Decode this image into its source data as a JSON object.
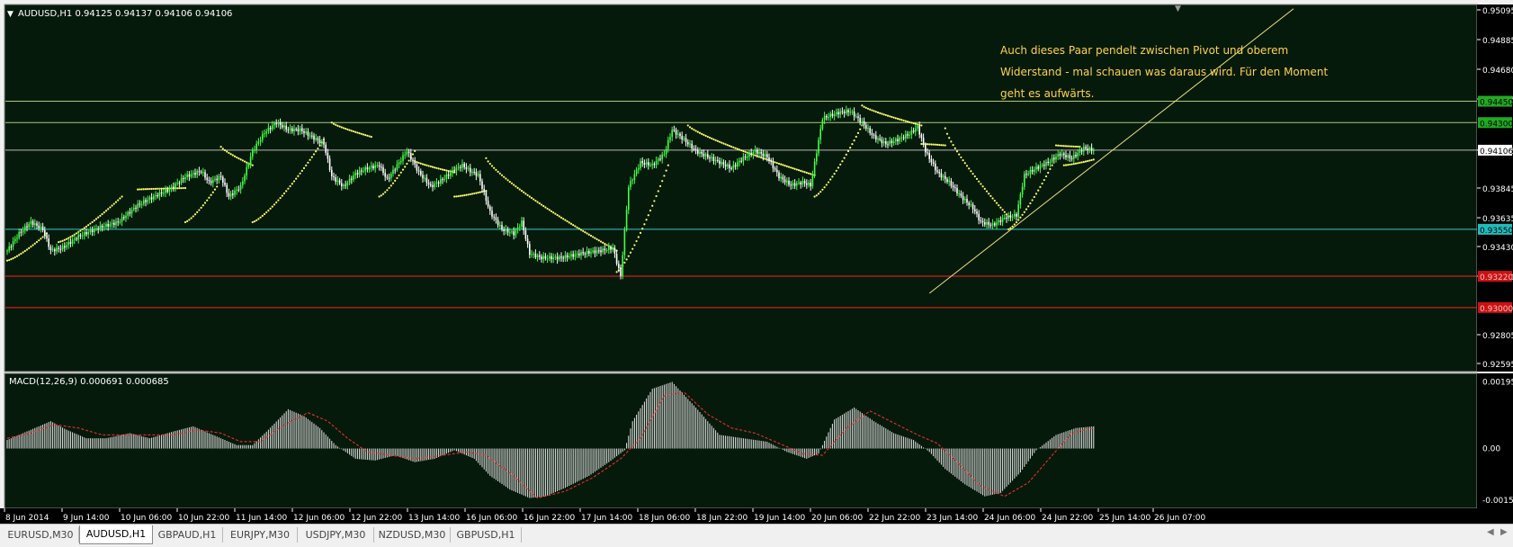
{
  "colors": {
    "background": "#061a0c",
    "grid_border": "#8a8a8a",
    "bull_candle": "#44ff44",
    "bear_candle": "#ffffff",
    "psar": "#ffff66",
    "level_green": "#a8c87a",
    "level_red": "#ff2020",
    "level_cyan": "#33cccc",
    "trendline": "#f0e07a",
    "annotation": "#ffd24a",
    "macd_hist": "#e8e8e8",
    "macd_signal": "#ff3030",
    "axis_text": "#ffffff"
  },
  "main_panel": {
    "header": "AUDUSD,H1  0.94125 0.94137 0.94106 0.94106",
    "annotation_lines": [
      "Auch dieses Paar pendelt zwischen Pivot und oberem",
      "Widerstand - mal schauen was daraus wird. Für den Moment",
      "geht es aufwärts."
    ]
  },
  "price_axis": {
    "ticks": [
      "0.95095",
      "0.94885",
      "0.94680",
      "0.94265",
      "0.94055",
      "0.93845",
      "0.93635",
      "0.93430",
      "0.93010",
      "0.92805",
      "0.92595"
    ],
    "level_tags": [
      {
        "text": "0.94450",
        "style": "green"
      },
      {
        "text": "0.94300",
        "style": "green"
      },
      {
        "text": "0.94106",
        "style": "current"
      },
      {
        "text": "0.93550",
        "style": "cyan"
      },
      {
        "text": "0.93220",
        "style": "red"
      },
      {
        "text": "0.93000",
        "style": "red"
      }
    ]
  },
  "chart_data": {
    "type": "candlestick",
    "symbol": "AUDUSD",
    "timeframe": "H1",
    "bid": 0.94106,
    "x_tick_labels": [
      "8 Jun 2014",
      "9 Jun 14:00",
      "10 Jun 06:00",
      "10 Jun 22:00",
      "11 Jun 14:00",
      "12 Jun 06:00",
      "12 Jun 22:00",
      "13 Jun 14:00",
      "16 Jun 06:00",
      "16 Jun 22:00",
      "17 Jun 14:00",
      "18 Jun 06:00",
      "18 Jun 22:00",
      "19 Jun 14:00",
      "20 Jun 06:00",
      "22 Jun 22:00",
      "23 Jun 14:00",
      "24 Jun 06:00",
      "24 Jun 22:00",
      "25 Jun 14:00",
      "26 Jun 07:00"
    ],
    "y_range": [
      0.9255,
      0.9513
    ],
    "close_path": [
      [
        0,
        0.934
      ],
      [
        6,
        0.9352
      ],
      [
        12,
        0.936
      ],
      [
        18,
        0.9355
      ],
      [
        22,
        0.934
      ],
      [
        28,
        0.9342
      ],
      [
        36,
        0.935
      ],
      [
        46,
        0.9356
      ],
      [
        56,
        0.936
      ],
      [
        66,
        0.9372
      ],
      [
        74,
        0.9378
      ],
      [
        82,
        0.9383
      ],
      [
        90,
        0.9392
      ],
      [
        98,
        0.9396
      ],
      [
        102,
        0.9388
      ],
      [
        108,
        0.9392
      ],
      [
        112,
        0.9378
      ],
      [
        118,
        0.9385
      ],
      [
        124,
        0.941
      ],
      [
        130,
        0.9423
      ],
      [
        136,
        0.943
      ],
      [
        142,
        0.9425
      ],
      [
        148,
        0.9425
      ],
      [
        154,
        0.942
      ],
      [
        160,
        0.9415
      ],
      [
        164,
        0.9392
      ],
      [
        170,
        0.9385
      ],
      [
        176,
        0.9394
      ],
      [
        182,
        0.9398
      ],
      [
        188,
        0.94
      ],
      [
        192,
        0.939
      ],
      [
        198,
        0.9402
      ],
      [
        202,
        0.941
      ],
      [
        208,
        0.9395
      ],
      [
        214,
        0.9385
      ],
      [
        220,
        0.939
      ],
      [
        226,
        0.9397
      ],
      [
        230,
        0.94
      ],
      [
        234,
        0.9396
      ],
      [
        238,
        0.9393
      ],
      [
        244,
        0.9367
      ],
      [
        250,
        0.9355
      ],
      [
        256,
        0.9352
      ],
      [
        260,
        0.936
      ],
      [
        264,
        0.9338
      ],
      [
        270,
        0.9335
      ],
      [
        280,
        0.9335
      ],
      [
        290,
        0.9338
      ],
      [
        300,
        0.934
      ],
      [
        306,
        0.9342
      ],
      [
        310,
        0.9322
      ],
      [
        314,
        0.9385
      ],
      [
        320,
        0.9402
      ],
      [
        326,
        0.94
      ],
      [
        332,
        0.9408
      ],
      [
        336,
        0.9425
      ],
      [
        342,
        0.9418
      ],
      [
        348,
        0.941
      ],
      [
        354,
        0.9406
      ],
      [
        360,
        0.9402
      ],
      [
        366,
        0.9398
      ],
      [
        372,
        0.9405
      ],
      [
        378,
        0.941
      ],
      [
        384,
        0.9406
      ],
      [
        390,
        0.9392
      ],
      [
        396,
        0.9386
      ],
      [
        402,
        0.9388
      ],
      [
        406,
        0.9386
      ],
      [
        412,
        0.9433
      ],
      [
        420,
        0.9437
      ],
      [
        426,
        0.9438
      ],
      [
        432,
        0.943
      ],
      [
        438,
        0.942
      ],
      [
        444,
        0.9415
      ],
      [
        450,
        0.9418
      ],
      [
        456,
        0.9422
      ],
      [
        460,
        0.9427
      ],
      [
        464,
        0.941
      ],
      [
        470,
        0.9395
      ],
      [
        476,
        0.9388
      ],
      [
        482,
        0.9378
      ],
      [
        488,
        0.937
      ],
      [
        492,
        0.936
      ],
      [
        498,
        0.9358
      ],
      [
        504,
        0.9363
      ],
      [
        510,
        0.9365
      ],
      [
        514,
        0.9393
      ],
      [
        520,
        0.9398
      ],
      [
        526,
        0.9402
      ],
      [
        532,
        0.9408
      ],
      [
        538,
        0.9405
      ],
      [
        544,
        0.9412
      ],
      [
        549,
        0.94106
      ]
    ],
    "psar_segments": [
      {
        "from": 0,
        "to": 20,
        "start": 0.9333,
        "end": 0.9352,
        "side": "below"
      },
      {
        "from": 26,
        "to": 58,
        "start": 0.9346,
        "end": 0.9378,
        "side": "below"
      },
      {
        "from": 66,
        "to": 90,
        "start": 0.9383,
        "end": 0.9384,
        "side": "above"
      },
      {
        "from": 90,
        "to": 106,
        "start": 0.936,
        "end": 0.9385,
        "side": "below"
      },
      {
        "from": 108,
        "to": 124,
        "start": 0.9413,
        "end": 0.94,
        "side": "above"
      },
      {
        "from": 124,
        "to": 160,
        "start": 0.936,
        "end": 0.9418,
        "side": "below"
      },
      {
        "from": 164,
        "to": 184,
        "start": 0.943,
        "end": 0.942,
        "side": "above"
      },
      {
        "from": 188,
        "to": 206,
        "start": 0.9378,
        "end": 0.941,
        "side": "below"
      },
      {
        "from": 206,
        "to": 226,
        "start": 0.9403,
        "end": 0.9395,
        "side": "above"
      },
      {
        "from": 226,
        "to": 242,
        "start": 0.9378,
        "end": 0.9382,
        "side": "below"
      },
      {
        "from": 242,
        "to": 308,
        "start": 0.9405,
        "end": 0.934,
        "side": "above"
      },
      {
        "from": 308,
        "to": 334,
        "start": 0.9325,
        "end": 0.94,
        "side": "below"
      },
      {
        "from": 344,
        "to": 408,
        "start": 0.9428,
        "end": 0.9393,
        "side": "above"
      },
      {
        "from": 408,
        "to": 432,
        "start": 0.9378,
        "end": 0.9428,
        "side": "below"
      },
      {
        "from": 432,
        "to": 462,
        "start": 0.9442,
        "end": 0.9428,
        "side": "above"
      },
      {
        "from": 462,
        "to": 474,
        "start": 0.9415,
        "end": 0.9414,
        "side": "below"
      },
      {
        "from": 474,
        "to": 506,
        "start": 0.9426,
        "end": 0.9364,
        "side": "above"
      },
      {
        "from": 506,
        "to": 528,
        "start": 0.9355,
        "end": 0.94,
        "side": "below"
      },
      {
        "from": 530,
        "to": 542,
        "start": 0.9414,
        "end": 0.9413,
        "side": "above"
      },
      {
        "from": 534,
        "to": 549,
        "start": 0.94,
        "end": 0.9404,
        "side": "below"
      }
    ],
    "horizontal_levels": [
      {
        "price": 0.9445,
        "color": "green"
      },
      {
        "price": 0.943,
        "color": "green"
      },
      {
        "price": 0.94106,
        "color": "current"
      },
      {
        "price": 0.9355,
        "color": "cyan"
      },
      {
        "price": 0.9322,
        "color": "red"
      },
      {
        "price": 0.93,
        "color": "red"
      }
    ],
    "trendline": {
      "x1": 466,
      "y1": 0.931,
      "x2": 650,
      "y2": 0.951
    }
  },
  "macd": {
    "header": "MACD(12,26,9) 0.000691 0.000685",
    "params": "12,26,9",
    "main_value": 0.000691,
    "signal_value": 0.000685,
    "y_ticks": [
      "0.001956",
      "0.00",
      "-0.001511"
    ],
    "y_range": [
      -0.00175,
      0.0022
    ],
    "hist_path": [
      [
        0,
        0.00025
      ],
      [
        10,
        0.0005
      ],
      [
        22,
        0.0008
      ],
      [
        30,
        0.00055
      ],
      [
        40,
        0.0003
      ],
      [
        50,
        0.0003
      ],
      [
        62,
        0.00045
      ],
      [
        72,
        0.0003
      ],
      [
        84,
        0.0005
      ],
      [
        94,
        0.00065
      ],
      [
        104,
        0.0004
      ],
      [
        116,
        0.0001
      ],
      [
        124,
        0.0001
      ],
      [
        132,
        0.00055
      ],
      [
        142,
        0.00115
      ],
      [
        150,
        0.00095
      ],
      [
        158,
        0.0006
      ],
      [
        166,
        0.0001
      ],
      [
        176,
        -0.0003
      ],
      [
        186,
        -0.00035
      ],
      [
        196,
        -0.0002
      ],
      [
        206,
        -0.0004
      ],
      [
        216,
        -0.0003
      ],
      [
        226,
        -5e-05
      ],
      [
        236,
        -0.0003
      ],
      [
        244,
        -0.0008
      ],
      [
        254,
        -0.0012
      ],
      [
        264,
        -0.00145
      ],
      [
        272,
        -0.0014
      ],
      [
        282,
        -0.00115
      ],
      [
        294,
        -0.0008
      ],
      [
        304,
        -0.0004
      ],
      [
        312,
        -5e-05
      ],
      [
        316,
        0.0008
      ],
      [
        326,
        0.00175
      ],
      [
        336,
        0.00195
      ],
      [
        348,
        0.0012
      ],
      [
        360,
        0.0004
      ],
      [
        372,
        0.0003
      ],
      [
        384,
        0.0002
      ],
      [
        394,
        -0.0001
      ],
      [
        404,
        -0.0003
      ],
      [
        410,
        -0.00015
      ],
      [
        418,
        0.00085
      ],
      [
        428,
        0.0012
      ],
      [
        438,
        0.0008
      ],
      [
        448,
        0.00045
      ],
      [
        458,
        0.00025
      ],
      [
        466,
        -0.0001
      ],
      [
        474,
        -0.0006
      ],
      [
        484,
        -0.00105
      ],
      [
        494,
        -0.0014
      ],
      [
        502,
        -0.0013
      ],
      [
        512,
        -0.0007
      ],
      [
        520,
        -5e-05
      ],
      [
        530,
        0.0004
      ],
      [
        540,
        0.0006
      ],
      [
        549,
        0.00065
      ]
    ],
    "signal_path": [
      [
        0,
        0.0003
      ],
      [
        12,
        0.00045
      ],
      [
        24,
        0.0007
      ],
      [
        36,
        0.0006
      ],
      [
        48,
        0.0004
      ],
      [
        60,
        0.0004
      ],
      [
        72,
        0.0004
      ],
      [
        84,
        0.0004
      ],
      [
        96,
        0.00055
      ],
      [
        108,
        0.00045
      ],
      [
        118,
        0.0002
      ],
      [
        128,
        0.0002
      ],
      [
        140,
        0.0007
      ],
      [
        152,
        0.00105
      ],
      [
        162,
        0.0008
      ],
      [
        172,
        0.0003
      ],
      [
        182,
        -0.0001
      ],
      [
        194,
        -0.0002
      ],
      [
        206,
        -0.0003
      ],
      [
        220,
        -0.0002
      ],
      [
        232,
        -0.0001
      ],
      [
        242,
        -0.0002
      ],
      [
        256,
        -0.0008
      ],
      [
        268,
        -0.00145
      ],
      [
        282,
        -0.00125
      ],
      [
        296,
        -0.00085
      ],
      [
        310,
        -0.0003
      ],
      [
        320,
        0.0003
      ],
      [
        332,
        0.00155
      ],
      [
        342,
        0.00165
      ],
      [
        354,
        0.001
      ],
      [
        366,
        0.0006
      ],
      [
        378,
        0.00045
      ],
      [
        390,
        0.00015
      ],
      [
        402,
        -0.00015
      ],
      [
        412,
        -0.0002
      ],
      [
        424,
        0.0006
      ],
      [
        436,
        0.0011
      ],
      [
        448,
        0.00075
      ],
      [
        460,
        0.0004
      ],
      [
        470,
        0.00015
      ],
      [
        480,
        -0.0004
      ],
      [
        492,
        -0.0011
      ],
      [
        504,
        -0.0014
      ],
      [
        516,
        -0.001
      ],
      [
        528,
        -0.0002
      ],
      [
        538,
        0.00045
      ],
      [
        549,
        0.0006
      ]
    ]
  },
  "tabs": [
    {
      "label": "EURUSD,M30",
      "active": false
    },
    {
      "label": "AUDUSD,H1",
      "active": true
    },
    {
      "label": "GBPAUD,H1",
      "active": false
    },
    {
      "label": "EURJPY,M30",
      "active": false
    },
    {
      "label": "USDJPY,M30",
      "active": false
    },
    {
      "label": "NZDUSD,M30",
      "active": false
    },
    {
      "label": "GBPUSD,H1",
      "active": false
    }
  ],
  "tab_nav": {
    "left": "◀",
    "right": "▶"
  }
}
